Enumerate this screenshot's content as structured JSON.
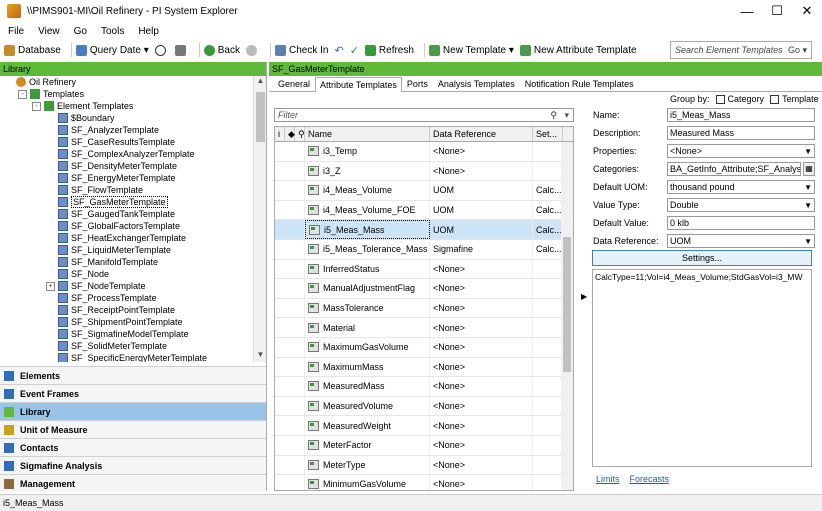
{
  "window": {
    "title": "\\\\PIMS901-MI\\Oil Refinery - PI System Explorer"
  },
  "menu": [
    "File",
    "View",
    "Go",
    "Tools",
    "Help"
  ],
  "toolbar": {
    "database": "Database",
    "query_date": "Query Date",
    "back": "Back",
    "check_in": "Check In",
    "refresh": "Refresh",
    "new_template": "New Template",
    "new_attribute_template": "New Attribute Template",
    "search_placeholder": "Search Element Templates",
    "search_go": "Go"
  },
  "library": {
    "header": "Library",
    "tree": [
      {
        "label": "Oil Refinery",
        "level": 0,
        "icon": "db"
      },
      {
        "label": "Templates",
        "level": 1,
        "icon": "folder",
        "expander": "-"
      },
      {
        "label": "Element Templates",
        "level": 2,
        "icon": "folder",
        "expander": "-"
      },
      {
        "label": "$Boundary",
        "level": 3,
        "icon": "tmpl"
      },
      {
        "label": "SF_AnalyzerTemplate",
        "level": 3,
        "icon": "tmpl"
      },
      {
        "label": "SF_CaseResultsTemplate",
        "level": 3,
        "icon": "tmpl"
      },
      {
        "label": "SF_ComplexAnalyzerTemplate",
        "level": 3,
        "icon": "tmpl"
      },
      {
        "label": "SF_DensityMeterTemplate",
        "level": 3,
        "icon": "tmpl"
      },
      {
        "label": "SF_EnergyMeterTemplate",
        "level": 3,
        "icon": "tmpl"
      },
      {
        "label": "SF_FlowTemplate",
        "level": 3,
        "icon": "tmpl"
      },
      {
        "label": "SF_GasMeterTemplate",
        "level": 3,
        "icon": "tmpl",
        "selected": true
      },
      {
        "label": "SF_GaugedTankTemplate",
        "level": 3,
        "icon": "tmpl"
      },
      {
        "label": "SF_GlobalFactorsTemplate",
        "level": 3,
        "icon": "tmpl"
      },
      {
        "label": "SF_HeatExchangerTemplate",
        "level": 3,
        "icon": "tmpl"
      },
      {
        "label": "SF_LiquidMeterTemplate",
        "level": 3,
        "icon": "tmpl"
      },
      {
        "label": "SF_ManifoldTemplate",
        "level": 3,
        "icon": "tmpl"
      },
      {
        "label": "SF_Node",
        "level": 3,
        "icon": "tmpl"
      },
      {
        "label": "SF_NodeTemplate",
        "level": 3,
        "icon": "tmpl",
        "expander": "+"
      },
      {
        "label": "SF_ProcessTemplate",
        "level": 3,
        "icon": "tmpl"
      },
      {
        "label": "SF_ReceiptPointTemplate",
        "level": 3,
        "icon": "tmpl"
      },
      {
        "label": "SF_ShipmentPointTemplate",
        "level": 3,
        "icon": "tmpl"
      },
      {
        "label": "SF_SigmafineModelTemplate",
        "level": 3,
        "icon": "tmpl"
      },
      {
        "label": "SF_SolidMeterTemplate",
        "level": 3,
        "icon": "tmpl"
      },
      {
        "label": "SF_SpecificEnergyMeterTemplate",
        "level": 3,
        "icon": "tmpl"
      }
    ]
  },
  "nav": [
    {
      "label": "Elements",
      "icon": "elements-icon",
      "color": "#2e6fb5"
    },
    {
      "label": "Event Frames",
      "icon": "event-frames-icon",
      "color": "#2e6fb5"
    },
    {
      "label": "Library",
      "icon": "library-icon",
      "color": "#5fb93a",
      "active": true
    },
    {
      "label": "Unit of Measure",
      "icon": "uom-icon",
      "color": "#c8a020"
    },
    {
      "label": "Contacts",
      "icon": "contacts-icon",
      "color": "#2e6fb5"
    },
    {
      "label": "Sigmafine Analysis",
      "icon": "sigmafine-icon",
      "color": "#2e6fb5"
    },
    {
      "label": "Management",
      "icon": "management-icon",
      "color": "#8a6a40"
    }
  ],
  "detail": {
    "header": "SF_GasMeterTemplate",
    "tabs": [
      "General",
      "Attribute Templates",
      "Ports",
      "Analysis Templates",
      "Notification Rule Templates"
    ],
    "active_tab": 1,
    "filter_placeholder": "Filter",
    "columns": {
      "name": "Name",
      "data_reference": "Data Reference",
      "settings": "Set..."
    },
    "rows": [
      {
        "name": "i3_Temp",
        "dr": "<None>",
        "set": ""
      },
      {
        "name": "i3_Z",
        "dr": "<None>",
        "set": ""
      },
      {
        "name": "i4_Meas_Volume",
        "dr": "UOM",
        "set": "Calc..."
      },
      {
        "name": "i4_Meas_Volume_FOE",
        "dr": "UOM",
        "set": "Calc..."
      },
      {
        "name": "i5_Meas_Mass",
        "dr": "UOM",
        "set": "Calc...",
        "selected": true
      },
      {
        "name": "i5_Meas_Tolerance_Mass",
        "dr": "Sigmafine",
        "set": "Calc..."
      },
      {
        "name": "InferredStatus",
        "dr": "<None>",
        "set": ""
      },
      {
        "name": "ManualAdjustmentFlag",
        "dr": "<None>",
        "set": ""
      },
      {
        "name": "MassTolerance",
        "dr": "<None>",
        "set": ""
      },
      {
        "name": "Material",
        "dr": "<None>",
        "set": ""
      },
      {
        "name": "MaximumGasVolume",
        "dr": "<None>",
        "set": ""
      },
      {
        "name": "MaximumMass",
        "dr": "<None>",
        "set": ""
      },
      {
        "name": "MeasuredMass",
        "dr": "<None>",
        "set": ""
      },
      {
        "name": "MeasuredVolume",
        "dr": "<None>",
        "set": ""
      },
      {
        "name": "MeasuredWeight",
        "dr": "<None>",
        "set": ""
      },
      {
        "name": "MeterFactor",
        "dr": "<None>",
        "set": ""
      },
      {
        "name": "MeterType",
        "dr": "<None>",
        "set": ""
      },
      {
        "name": "MinimumGasVolume",
        "dr": "<None>",
        "set": ""
      }
    ],
    "group_by": {
      "label": "Group by:",
      "category": "Category",
      "template": "Template"
    },
    "properties": {
      "name_label": "Name:",
      "name": "i5_Meas_Mass",
      "description_label": "Description:",
      "description": "Measured Mass",
      "properties_label": "Properties:",
      "properties": "<None>",
      "categories_label": "Categories:",
      "categories": "BA_GetInfo_Attribute;SF_AnalysisI",
      "default_uom_label": "Default UOM:",
      "default_uom": "thousand pound",
      "value_type_label": "Value Type:",
      "value_type": "Double",
      "default_value_label": "Default Value:",
      "default_value": "0 klb",
      "data_reference_label": "Data Reference:",
      "data_reference": "UOM",
      "settings_button": "Settings...",
      "config_string": "CalcType=11;Vol=i4_Meas_Volume;StdGasVol=i3_MW"
    },
    "links": {
      "limits": "Limits",
      "forecasts": "Forecasts"
    }
  },
  "status": "i5_Meas_Mass"
}
